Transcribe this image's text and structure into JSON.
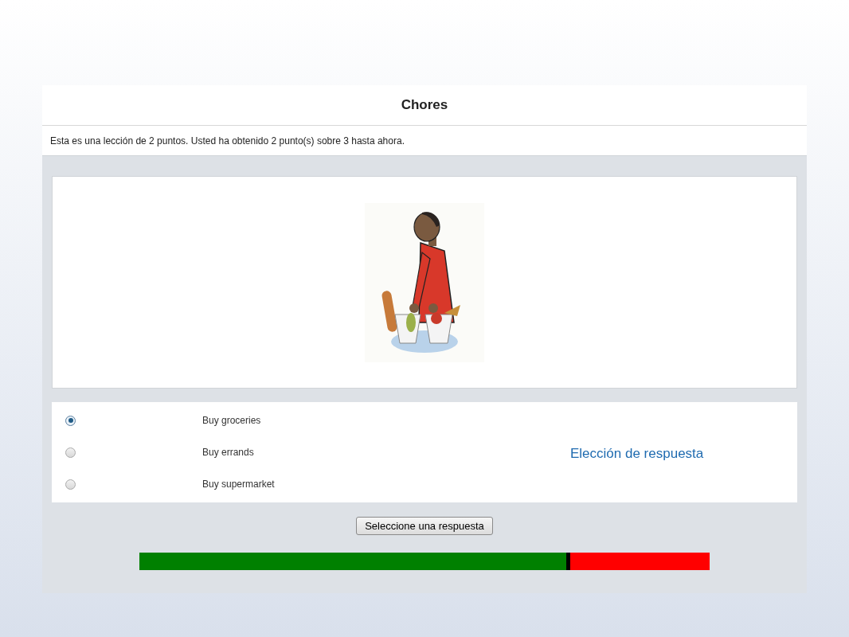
{
  "lesson": {
    "title": "Chores",
    "info": "Esta es una lección de 2 puntos. Usted ha obtenido 2 punto(s) sobre 3 hasta ahora."
  },
  "answers": [
    {
      "label": "Buy groceries",
      "selected": true
    },
    {
      "label": "Buy errands",
      "selected": false
    },
    {
      "label": "Buy supermarket",
      "selected": false
    }
  ],
  "annotation": "Elección de respuesta",
  "submit_button": "Seleccione una respuesta",
  "progress": {
    "level": 0.755
  }
}
